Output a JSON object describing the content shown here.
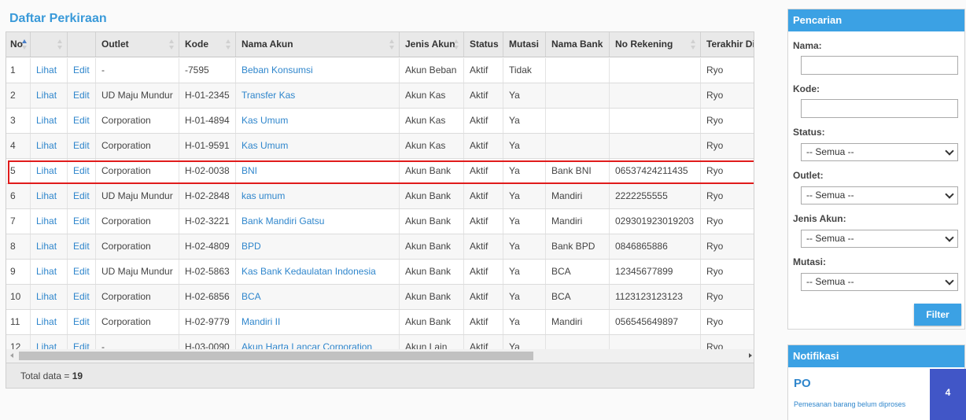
{
  "page": {
    "title": "Daftar Perkiraan"
  },
  "table": {
    "headers": [
      "No",
      "",
      "",
      "Outlet",
      "Kode",
      "Nama Akun",
      "Jenis Akun",
      "Status",
      "Mutasi",
      "Nama Bank",
      "No Rekening",
      "Terakhir Diedi"
    ],
    "rows": [
      {
        "no": "1",
        "view": "Lihat",
        "edit": "Edit",
        "outlet": "-",
        "kode": "-7595",
        "nama": "Beban Konsumsi",
        "jenis": "Akun Beban",
        "status": "Aktif",
        "mutasi": "Tidak",
        "bank": "",
        "rekening": "",
        "editor": "Ryo"
      },
      {
        "no": "2",
        "view": "Lihat",
        "edit": "Edit",
        "outlet": "UD Maju Mundur",
        "kode": "H-01-2345",
        "nama": "Transfer Kas",
        "jenis": "Akun Kas",
        "status": "Aktif",
        "mutasi": "Ya",
        "bank": "",
        "rekening": "",
        "editor": "Ryo"
      },
      {
        "no": "3",
        "view": "Lihat",
        "edit": "Edit",
        "outlet": "Corporation",
        "kode": "H-01-4894",
        "nama": "Kas Umum",
        "jenis": "Akun Kas",
        "status": "Aktif",
        "mutasi": "Ya",
        "bank": "",
        "rekening": "",
        "editor": "Ryo"
      },
      {
        "no": "4",
        "view": "Lihat",
        "edit": "Edit",
        "outlet": "Corporation",
        "kode": "H-01-9591",
        "nama": "Kas Umum",
        "jenis": "Akun Kas",
        "status": "Aktif",
        "mutasi": "Ya",
        "bank": "",
        "rekening": "",
        "editor": "Ryo"
      },
      {
        "no": "5",
        "view": "Lihat",
        "edit": "Edit",
        "outlet": "Corporation",
        "kode": "H-02-0038",
        "nama": "BNI",
        "jenis": "Akun Bank",
        "status": "Aktif",
        "mutasi": "Ya",
        "bank": "Bank BNI",
        "rekening": "06537424211435",
        "editor": "Ryo"
      },
      {
        "no": "6",
        "view": "Lihat",
        "edit": "Edit",
        "outlet": "UD Maju Mundur",
        "kode": "H-02-2848",
        "nama": "kas umum",
        "jenis": "Akun Bank",
        "status": "Aktif",
        "mutasi": "Ya",
        "bank": "Mandiri",
        "rekening": "2222255555",
        "editor": "Ryo"
      },
      {
        "no": "7",
        "view": "Lihat",
        "edit": "Edit",
        "outlet": "Corporation",
        "kode": "H-02-3221",
        "nama": "Bank Mandiri Gatsu",
        "jenis": "Akun Bank",
        "status": "Aktif",
        "mutasi": "Ya",
        "bank": "Mandiri",
        "rekening": "029301923019203",
        "editor": "Ryo"
      },
      {
        "no": "8",
        "view": "Lihat",
        "edit": "Edit",
        "outlet": "Corporation",
        "kode": "H-02-4809",
        "nama": "BPD",
        "jenis": "Akun Bank",
        "status": "Aktif",
        "mutasi": "Ya",
        "bank": "Bank BPD",
        "rekening": "0846865886",
        "editor": "Ryo"
      },
      {
        "no": "9",
        "view": "Lihat",
        "edit": "Edit",
        "outlet": "UD Maju Mundur",
        "kode": "H-02-5863",
        "nama": "Kas Bank Kedaulatan Indonesia",
        "jenis": "Akun Bank",
        "status": "Aktif",
        "mutasi": "Ya",
        "bank": "BCA",
        "rekening": "12345677899",
        "editor": "Ryo"
      },
      {
        "no": "10",
        "view": "Lihat",
        "edit": "Edit",
        "outlet": "Corporation",
        "kode": "H-02-6856",
        "nama": "BCA",
        "jenis": "Akun Bank",
        "status": "Aktif",
        "mutasi": "Ya",
        "bank": "BCA",
        "rekening": "1123123123123",
        "editor": "Ryo"
      },
      {
        "no": "11",
        "view": "Lihat",
        "edit": "Edit",
        "outlet": "Corporation",
        "kode": "H-02-9779",
        "nama": "Mandiri II",
        "jenis": "Akun Bank",
        "status": "Aktif",
        "mutasi": "Ya",
        "bank": "Mandiri",
        "rekening": "056545649897",
        "editor": "Ryo"
      },
      {
        "no": "12",
        "view": "Lihat",
        "edit": "Edit",
        "outlet": "-",
        "kode": "H-03-0090",
        "nama": "Akun Harta Lancar Corporation",
        "jenis": "Akun Lain",
        "status": "Aktif",
        "mutasi": "Ya",
        "bank": "",
        "rekening": "",
        "editor": "Ryo"
      }
    ],
    "footer_label": "Total data =",
    "footer_value": "19"
  },
  "search": {
    "title": "Pencarian",
    "nama_label": "Nama:",
    "kode_label": "Kode:",
    "status_label": "Status:",
    "status_value": "-- Semua --",
    "outlet_label": "Outlet:",
    "outlet_value": "-- Semua --",
    "jenis_label": "Jenis Akun:",
    "jenis_value": "-- Semua --",
    "mutasi_label": "Mutasi:",
    "mutasi_value": "-- Semua --",
    "filter_label": "Filter"
  },
  "notif": {
    "title": "Notifikasi",
    "item_title": "PO",
    "item_text": "Pemesanan barang belum diproses",
    "item_count": "4"
  },
  "colors": {
    "accent": "#3ba1e4",
    "link": "#2f86cc",
    "highlight": "#e01b1b",
    "badge": "#4156c7"
  }
}
